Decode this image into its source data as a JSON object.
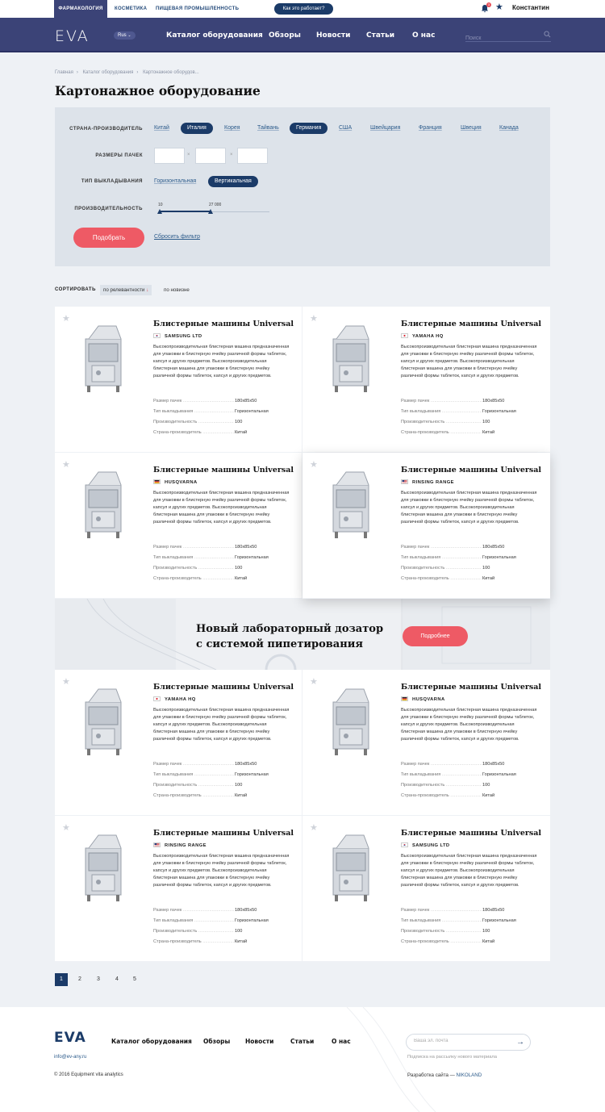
{
  "topbar": {
    "tabs": [
      "ФАРМАКОЛОГИЯ",
      "КОСМЕТИКА",
      "ПИЩЕВАЯ ПРОМЫШЛЕННОСТЬ"
    ],
    "how_label": "Как это работает?",
    "badge": "3",
    "user": "Константин"
  },
  "nav": {
    "logo": "EVA",
    "lang": "Rus",
    "items": [
      "Каталог оборудования",
      "Обзоры",
      "Новости",
      "Статьи",
      "О нас"
    ],
    "search_placeholder": "Поиск"
  },
  "breadcrumb": [
    "Главная",
    "Каталог оборудования",
    "Картонажное оборудов..."
  ],
  "page_title": "Картонажное оборудование",
  "filter": {
    "country_label": "СТРАНА-ПРОИЗВОДИТЕЛЬ",
    "countries": [
      "Китай",
      "Италия",
      "Корея",
      "Тайвань",
      "Германия",
      "США",
      "Швейцария",
      "Франция",
      "Швеция",
      "Канада"
    ],
    "selected_countries": [
      "Италия",
      "Германия"
    ],
    "size_label": "РАЗМЕРЫ ПАЧЕК",
    "layout_label": "ТИП ВЫКЛАДЫВАНИЯ",
    "layouts": [
      "Горизонтальная",
      "Вертикальная"
    ],
    "selected_layout": "Вертикальная",
    "perf_label": "ПРОИЗВОДИТЕЛЬНОСТЬ",
    "range_min": "10",
    "range_max": "27 000",
    "range_value": 0.46,
    "apply": "Подобрать",
    "reset": "Сбросить фильтр"
  },
  "sort": {
    "label": "СОРТИРОВАТЬ",
    "relevance": "по релевантности",
    "newest": "по новизне"
  },
  "spec_labels": [
    "Размер пачек",
    "Тип выкладывания",
    "Производительность",
    "Страна-производитель"
  ],
  "products": [
    {
      "title": "Блистерные машины Universal",
      "brand": "SAMSUNG LTD",
      "flag": "kr",
      "desc": "Высокопроизводительная блистерная машина предназначенная для упаковки в блистерную ячейку различной формы таблеток, капсул и других предметов. Высокопроизводительная блистерная машина для упаковки в блистерную ячейку различной формы таблеток, капсул и других предметов.",
      "specs": [
        "180х85х50",
        "Горизонтальная",
        "100",
        "Китай"
      ]
    },
    {
      "title": "Блистерные машины Universal",
      "brand": "YAMAHA HQ",
      "flag": "jp",
      "desc": "Высокопроизводительная блистерная машина предназначенная для упаковки в блистерную ячейку различной формы таблеток, капсул и других предметов. Высокопроизводительная блистерная машина для упаковки в блистерную ячейку различной формы таблеток, капсул и других предметов.",
      "specs": [
        "180х85х50",
        "Горизонтальная",
        "100",
        "Китай"
      ]
    },
    {
      "title": "Блистерные машины Universal",
      "brand": "HUSQVARNA",
      "flag": "de",
      "desc": "Высокопроизводительная блистерная машина предназначенная для упаковки в блистерную ячейку различной формы таблеток, капсул и других предметов. Высокопроизводительная блистерная машина для упаковки в блистерную ячейку различной формы таблеток, капсул и других предметов.",
      "specs": [
        "180х85х50",
        "Горизонтальная",
        "100",
        "Китай"
      ]
    },
    {
      "title": "Блистерные машины Universal",
      "brand": "RINSING RANGE",
      "flag": "us",
      "desc": "Высокопроизводительная блистерная машина предназначенная для упаковки в блистерную ячейку различной формы таблеток, капсул и других предметов. Высокопроизводительная блистерная машина для упаковки в блистерную ячейку различной формы таблеток, капсул и других предметов.",
      "specs": [
        "180х85х50",
        "Горизонтальная",
        "100",
        "Китай"
      ]
    },
    {
      "title": "Блистерные машины Universal",
      "brand": "YAMAHA HQ",
      "flag": "jp",
      "desc": "Высокопроизводительная блистерная машина предназначенная для упаковки в блистерную ячейку различной формы таблеток, капсул и других предметов. Высокопроизводительная блистерная машина для упаковки в блистерную ячейку различной формы таблеток, капсул и других предметов.",
      "specs": [
        "180х85х50",
        "Горизонтальная",
        "100",
        "Китай"
      ]
    },
    {
      "title": "Блистерные машины Universal",
      "brand": "HUSQVARNA",
      "flag": "de",
      "desc": "Высокопроизводительная блистерная машина предназначенная для упаковки в блистерную ячейку различной формы таблеток, капсул и других предметов. Высокопроизводительная блистерная машина для упаковки в блистерную ячейку различной формы таблеток, капсул и других предметов.",
      "specs": [
        "180х85х50",
        "Горизонтальная",
        "100",
        "Китай"
      ]
    },
    {
      "title": "Блистерные машины Universal",
      "brand": "RINSING RANGE",
      "flag": "us",
      "desc": "Высокопроизводительная блистерная машина предназначенная для упаковки в блистерную ячейку различной формы таблеток, капсул и других предметов. Высокопроизводительная блистерная машина для упаковки в блистерную ячейку различной формы таблеток, капсул и других предметов.",
      "specs": [
        "180х85х50",
        "Горизонтальная",
        "100",
        "Китай"
      ]
    },
    {
      "title": "Блистерные машины Universal",
      "brand": "SAMSUNG LTD",
      "flag": "kr",
      "desc": "Высокопроизводительная блистерная машина предназначенная для упаковки в блистерную ячейку различной формы таблеток, капсул и других предметов. Высокопроизводительная блистерная машина для упаковки в блистерную ячейку различной формы таблеток, капсул и других предметов.",
      "specs": [
        "180х85х50",
        "Горизонтальная",
        "100",
        "Китай"
      ]
    }
  ],
  "banner": {
    "line1": "Новый лабораторный дозатор",
    "line2": "с системой пипетирования",
    "button": "Подробнее"
  },
  "pagination": [
    "1",
    "2",
    "3",
    "4",
    "5"
  ],
  "footer": {
    "logo": "EVA",
    "nav": [
      "Каталог оборудования",
      "Обзоры",
      "Новости",
      "Статьи",
      "О нас"
    ],
    "email": "info@ev-any.ru",
    "copyright": "© 2016 Equipment vita analytics",
    "email_placeholder": "Ваша эл. почта",
    "subscribe_note": "Подписка на рассылку нового материала",
    "dev_prefix": "Разработка сайта — ",
    "dev_name": "NIKOLAND"
  },
  "colors": {
    "primary": "#1b3b68",
    "nav": "#3b4377",
    "accent": "#ee5a65"
  }
}
